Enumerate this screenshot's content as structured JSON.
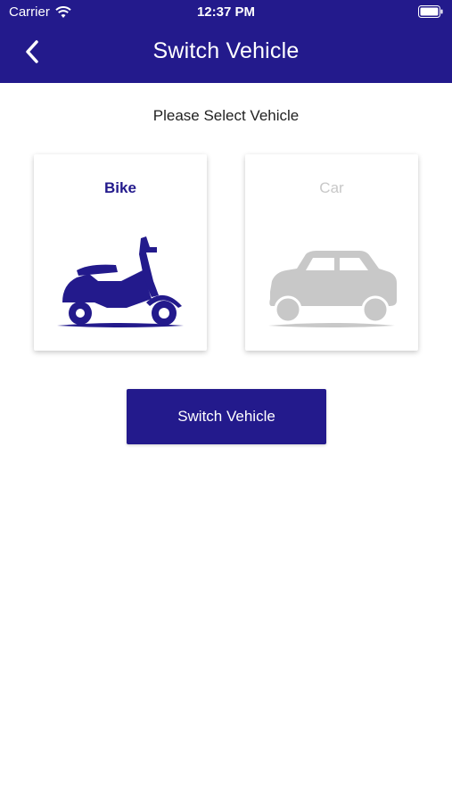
{
  "status_bar": {
    "carrier": "Carrier",
    "time": "12:37 PM"
  },
  "header": {
    "title": "Switch Vehicle",
    "back_icon": "chevron-left-icon"
  },
  "prompt": "Please Select Vehicle",
  "vehicles": [
    {
      "label": "Bike",
      "icon": "scooter-icon",
      "selected": true
    },
    {
      "label": "Car",
      "icon": "car-icon",
      "selected": false
    }
  ],
  "action": {
    "label": "Switch Vehicle"
  },
  "colors": {
    "primary": "#231a8c",
    "inactive": "#c8c8c8",
    "background": "#ffffff"
  }
}
